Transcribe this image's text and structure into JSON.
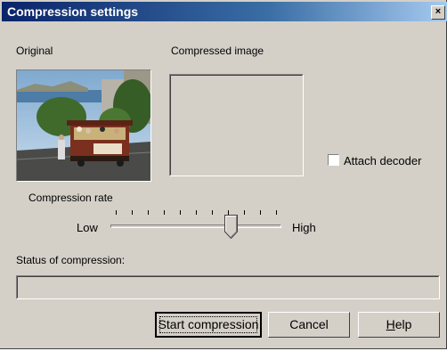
{
  "window": {
    "title": "Compression settings",
    "close_glyph": "×"
  },
  "original": {
    "label": "Original",
    "image": "cable-car-photo"
  },
  "compressed": {
    "label": "Compressed image"
  },
  "attach_decoder": {
    "label": "Attach decoder",
    "checked": false
  },
  "compression_rate": {
    "label": "Compression rate",
    "low_label": "Low",
    "high_label": "High",
    "position_fraction": 0.7
  },
  "status": {
    "label": "Status of compression:",
    "progress_fraction": 0
  },
  "buttons": {
    "start": "Start compression",
    "cancel": "Cancel",
    "help_prefix": "",
    "help_mnemonic": "H",
    "help_rest": "elp"
  }
}
